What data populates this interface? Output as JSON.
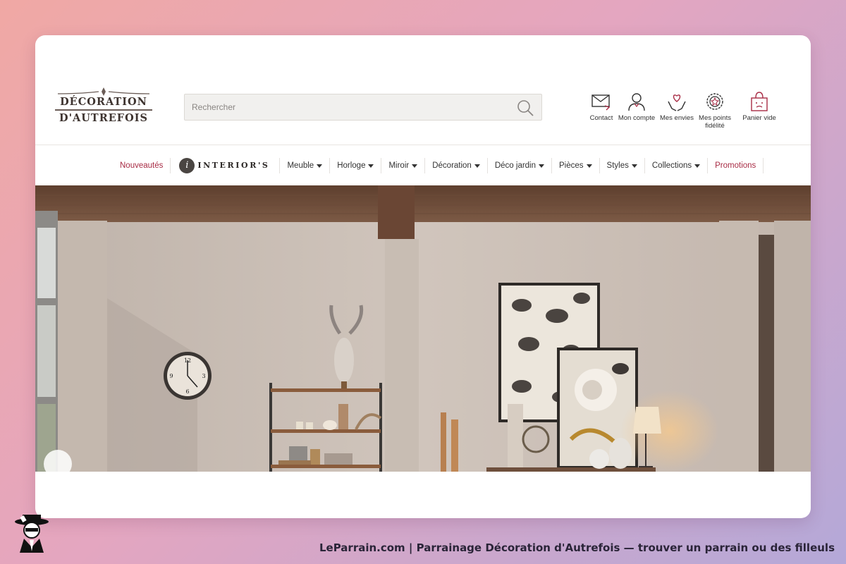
{
  "brand": {
    "logo_line1": "DÉCORATION",
    "logo_line2": "D'AUTREFOIS"
  },
  "search": {
    "placeholder": "Rechercher"
  },
  "header_links": [
    {
      "label": "Contact",
      "icon": "envelope-icon"
    },
    {
      "label": "Mon compte",
      "icon": "user-icon"
    },
    {
      "label": "Mes envies",
      "icon": "heart-hands-icon"
    },
    {
      "label": "Mes points fidélité",
      "icon": "loyalty-badge-icon"
    },
    {
      "label": "Panier vide",
      "icon": "shopping-bag-icon"
    }
  ],
  "nav": {
    "new": "Nouveautés",
    "interiors_mark": "i",
    "interiors": "INTERIOR'S",
    "items": [
      "Meuble",
      "Horloge",
      "Miroir",
      "Décoration",
      "Déco jardin",
      "Pièces",
      "Styles",
      "Collections"
    ],
    "promotions": "Promotions"
  },
  "clock_numbers": [
    "12",
    "3",
    "6",
    "9"
  ],
  "colors": {
    "accent": "#a82c45",
    "text": "#333333",
    "beam": "#6e4f3c",
    "wall": "#cbbfb6"
  },
  "caption": "LeParrain.com | Parrainage Décoration d'Autrefois — trouver un parrain ou des filleuls"
}
